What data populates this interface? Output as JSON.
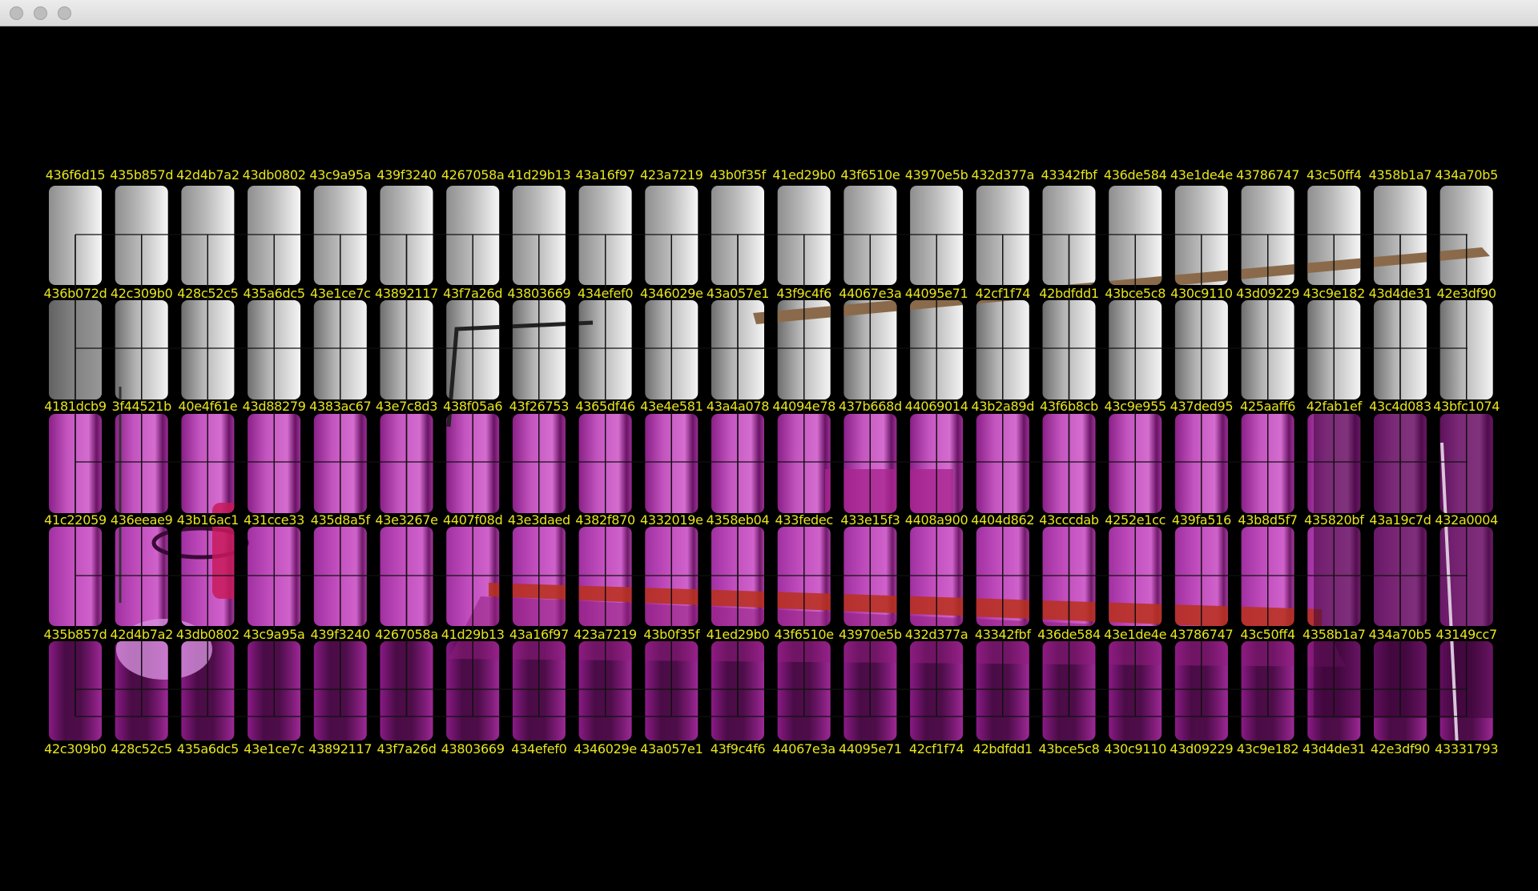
{
  "window": {
    "traffic_lights": [
      "close-button",
      "minimize-button",
      "zoom-button"
    ]
  },
  "colors": {
    "label": "#e8e51f",
    "background": "#000000",
    "tile_grey_dark": "#8a8a8a",
    "tile_grey_light": "#f2f2f2",
    "tile_magenta": "#d060cc",
    "tile_magenta_dark": "#4a0a44",
    "ladder": "#8a6a4a"
  },
  "label_rows": [
    [
      "436f6d15",
      "435b857d",
      "42d4b7a2",
      "43db0802",
      "43c9a95a",
      "439f3240",
      "4267058a",
      "41d29b13",
      "43a16f97",
      "423a7219",
      "43b0f35f",
      "41ed29b0",
      "43f6510e",
      "43970e5b",
      "432d377a",
      "43342fbf",
      "436de584",
      "43e1de4e",
      "43786747",
      "43c50ff4",
      "4358b1a7",
      "434a70b5"
    ],
    [
      "436b072d",
      "42c309b0",
      "428c52c5",
      "435a6dc5",
      "43e1ce7c",
      "43892117",
      "43f7a26d",
      "43803669",
      "434efef0",
      "4346029e",
      "43a057e1",
      "43f9c4f6",
      "44067e3a",
      "44095e71",
      "42cf1f74",
      "42bdfdd1",
      "43bce5c8",
      "430c9110",
      "43d09229",
      "43c9e182",
      "43d4de31",
      "42e3df90"
    ],
    [
      "4181dcb9",
      "3f44521b",
      "40e4f61e",
      "43d88279",
      "4383ac67",
      "43e7c8d3",
      "438f05a6",
      "43f26753",
      "4365df46",
      "43e4e581",
      "43a4a078",
      "44094e78",
      "437b668d",
      "44069014",
      "43b2a89d",
      "43f6b8cb",
      "43c9e955",
      "437ded95",
      "425aaff6",
      "42fab1ef",
      "43c4d083",
      "43bfc1074"
    ],
    [
      "41c22059",
      "436eeae9",
      "43b16ac1",
      "431cce33",
      "435d8a5f",
      "43e3267e",
      "4407f08d",
      "43e3daed",
      "4382f870",
      "4332019e",
      "4358eb04",
      "433fedec",
      "433e15f3",
      "4408a900",
      "4404d862",
      "43cccdab",
      "4252e1cc",
      "439fa516",
      "43b8d5f7",
      "435820bf",
      "43a19c7d",
      "432a0004"
    ],
    [
      "435b857d",
      "42d4b7a2",
      "43db0802",
      "43c9a95a",
      "439f3240",
      "4267058a",
      "41d29b13",
      "43a16f97",
      "423a7219",
      "43b0f35f",
      "41ed29b0",
      "43f6510e",
      "43970e5b",
      "432d377a",
      "43342fbf",
      "436de584",
      "43e1de4e",
      "43786747",
      "43c50ff4",
      "4358b1a7",
      "434a70b5",
      "43149cc7"
    ],
    [
      "42c309b0",
      "428c52c5",
      "435a6dc5",
      "43e1ce7c",
      "43892117",
      "43f7a26d",
      "43803669",
      "434efef0",
      "4346029e",
      "43a057e1",
      "43f9c4f6",
      "44067e3a",
      "44095e71",
      "42cf1f74",
      "42bdfdd1",
      "43bce5c8",
      "430c9110",
      "43d09229",
      "43c9e182",
      "43d4de31",
      "42e3df90",
      "43331793"
    ]
  ]
}
